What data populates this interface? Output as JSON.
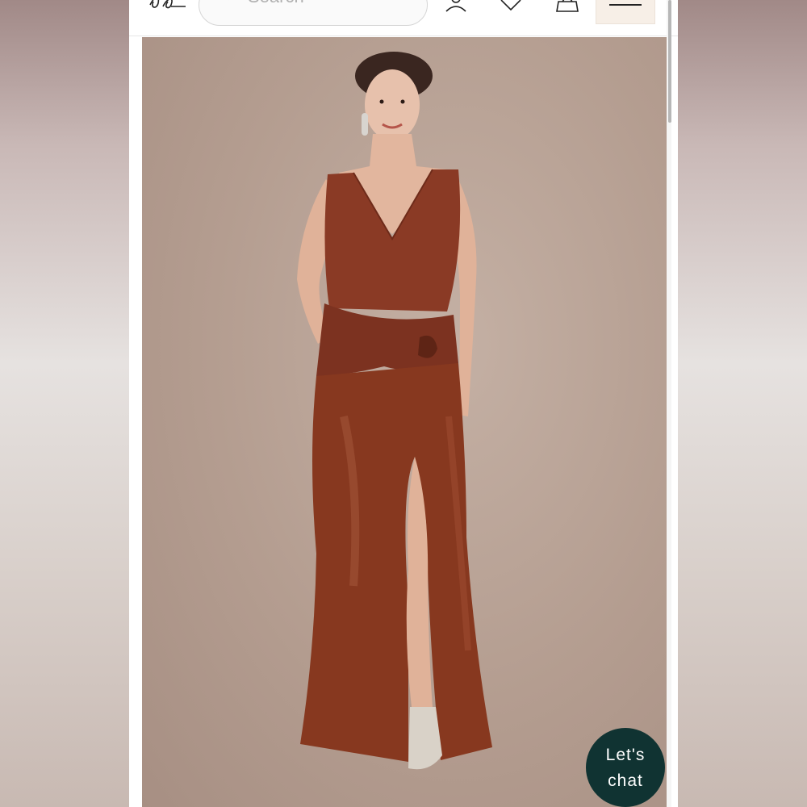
{
  "header": {
    "search_placeholder": "Search"
  },
  "icons": {
    "logo": "brand-logo-icon",
    "search": "search-icon",
    "account": "account-icon",
    "wishlist": "heart-icon",
    "bag": "shopping-bag-icon",
    "menu": "hamburger-menu-icon"
  },
  "product": {
    "image": "model-in-rust-satin-gown"
  },
  "chat": {
    "line1": "Let's",
    "line2": "chat"
  },
  "colors": {
    "chat_bg": "#103332",
    "menu_bg": "#f7efe7",
    "dress": "#8a3a25",
    "backdrop": "#b49d90"
  }
}
